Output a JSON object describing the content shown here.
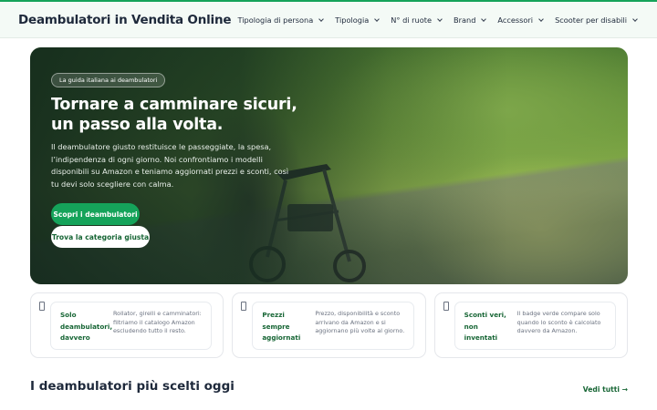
{
  "site": {
    "title": "Deambulatori in Vendita Online"
  },
  "nav": {
    "items": [
      {
        "label": "Tipologia di persona"
      },
      {
        "label": "Tipologia"
      },
      {
        "label": "N° di ruote"
      },
      {
        "label": "Brand"
      },
      {
        "label": "Accessori"
      },
      {
        "label": "Scooter per disabili"
      }
    ]
  },
  "hero": {
    "badge": "La guida italiana ai deambulatori",
    "title": "Tornare a camminare sicuri, un passo alla volta.",
    "text": "Il deambulatore giusto restituisce le passeggiate, la spesa, l’indipendenza di ogni giorno. Noi confrontiamo i modelli disponibili su Amazon e teniamo aggiornati prezzi e sconti, così tu devi solo scegliere con calma.",
    "primary_cta": "Scopri i deambulatori",
    "secondary_cta": "Trova la categoria giusta"
  },
  "features": [
    {
      "title": "Solo deambulatori, davvero",
      "desc": "Rollator, girelli e camminatori: filtriamo il catalogo Amazon escludendo tutto il resto."
    },
    {
      "title": "Prezzi sempre aggiornati",
      "desc": "Prezzo, disponibilità e sconto arrivano da Amazon e si aggiornano più volte al giorno."
    },
    {
      "title": "Sconti veri, non inventati",
      "desc": "Il badge verde compare solo quando lo sconto è calcolato davvero da Amazon."
    }
  ],
  "section": {
    "title": "I deambulatori più scelti oggi",
    "see_all": "Vedi tutti →"
  },
  "colors": {
    "accent": "#15a35a",
    "accent_dark": "#166534"
  }
}
